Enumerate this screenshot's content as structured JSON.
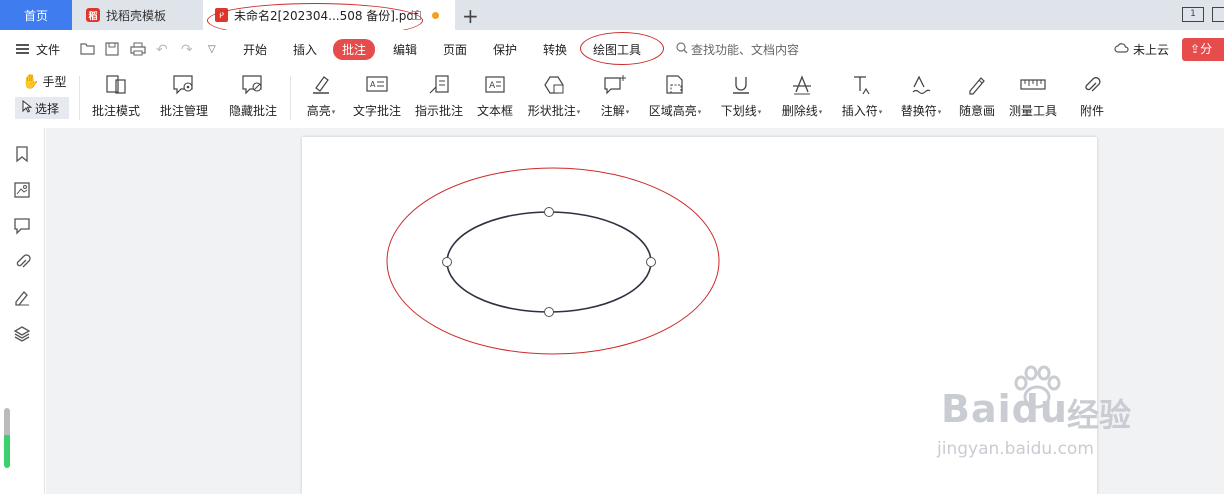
{
  "tabs": {
    "home": "首页",
    "templates": "找稻壳模板",
    "document": "未命名2[202304...508 备份].pdf"
  },
  "menu": {
    "file": "文件",
    "tabs": [
      "开始",
      "插入",
      "批注",
      "编辑",
      "页面",
      "保护",
      "转换",
      "绘图工具"
    ],
    "active_tab": "批注",
    "search_hint": "查找功能、文档内容",
    "cloud": "未上云",
    "share": "分"
  },
  "ribbon": {
    "hand": "手型",
    "select": "选择",
    "tools": [
      {
        "label": "批注模式",
        "icon": "annotation-mode-icon"
      },
      {
        "label": "批注管理",
        "icon": "annotation-manage-icon"
      },
      {
        "label": "隐藏批注",
        "icon": "hide-annotation-icon"
      },
      {
        "label": "高亮",
        "icon": "highlight-icon",
        "dropdown": true
      },
      {
        "label": "文字批注",
        "icon": "text-annotation-icon"
      },
      {
        "label": "指示批注",
        "icon": "pointer-annotation-icon"
      },
      {
        "label": "文本框",
        "icon": "textbox-icon"
      },
      {
        "label": "形状批注",
        "icon": "shape-annotation-icon",
        "dropdown": true
      },
      {
        "label": "注解",
        "icon": "note-icon",
        "dropdown": true
      },
      {
        "label": "区域高亮",
        "icon": "area-highlight-icon",
        "dropdown": true
      },
      {
        "label": "下划线",
        "icon": "underline-icon",
        "dropdown": true
      },
      {
        "label": "删除线",
        "icon": "strikethrough-icon",
        "dropdown": true
      },
      {
        "label": "插入符",
        "icon": "insert-caret-icon",
        "dropdown": true
      },
      {
        "label": "替换符",
        "icon": "replace-caret-icon",
        "dropdown": true
      },
      {
        "label": "随意画",
        "icon": "freehand-icon"
      },
      {
        "label": "测量工具",
        "icon": "ruler-icon"
      },
      {
        "label": "附件",
        "icon": "paperclip-icon"
      }
    ]
  },
  "watermark": {
    "brand": "Baidu",
    "cn": "经验",
    "url": "jingyan.baidu.com"
  },
  "colors": {
    "accent_blue": "#3e7cf0",
    "active_red": "#e74c4c",
    "annotation_red": "#cc2a2a"
  }
}
